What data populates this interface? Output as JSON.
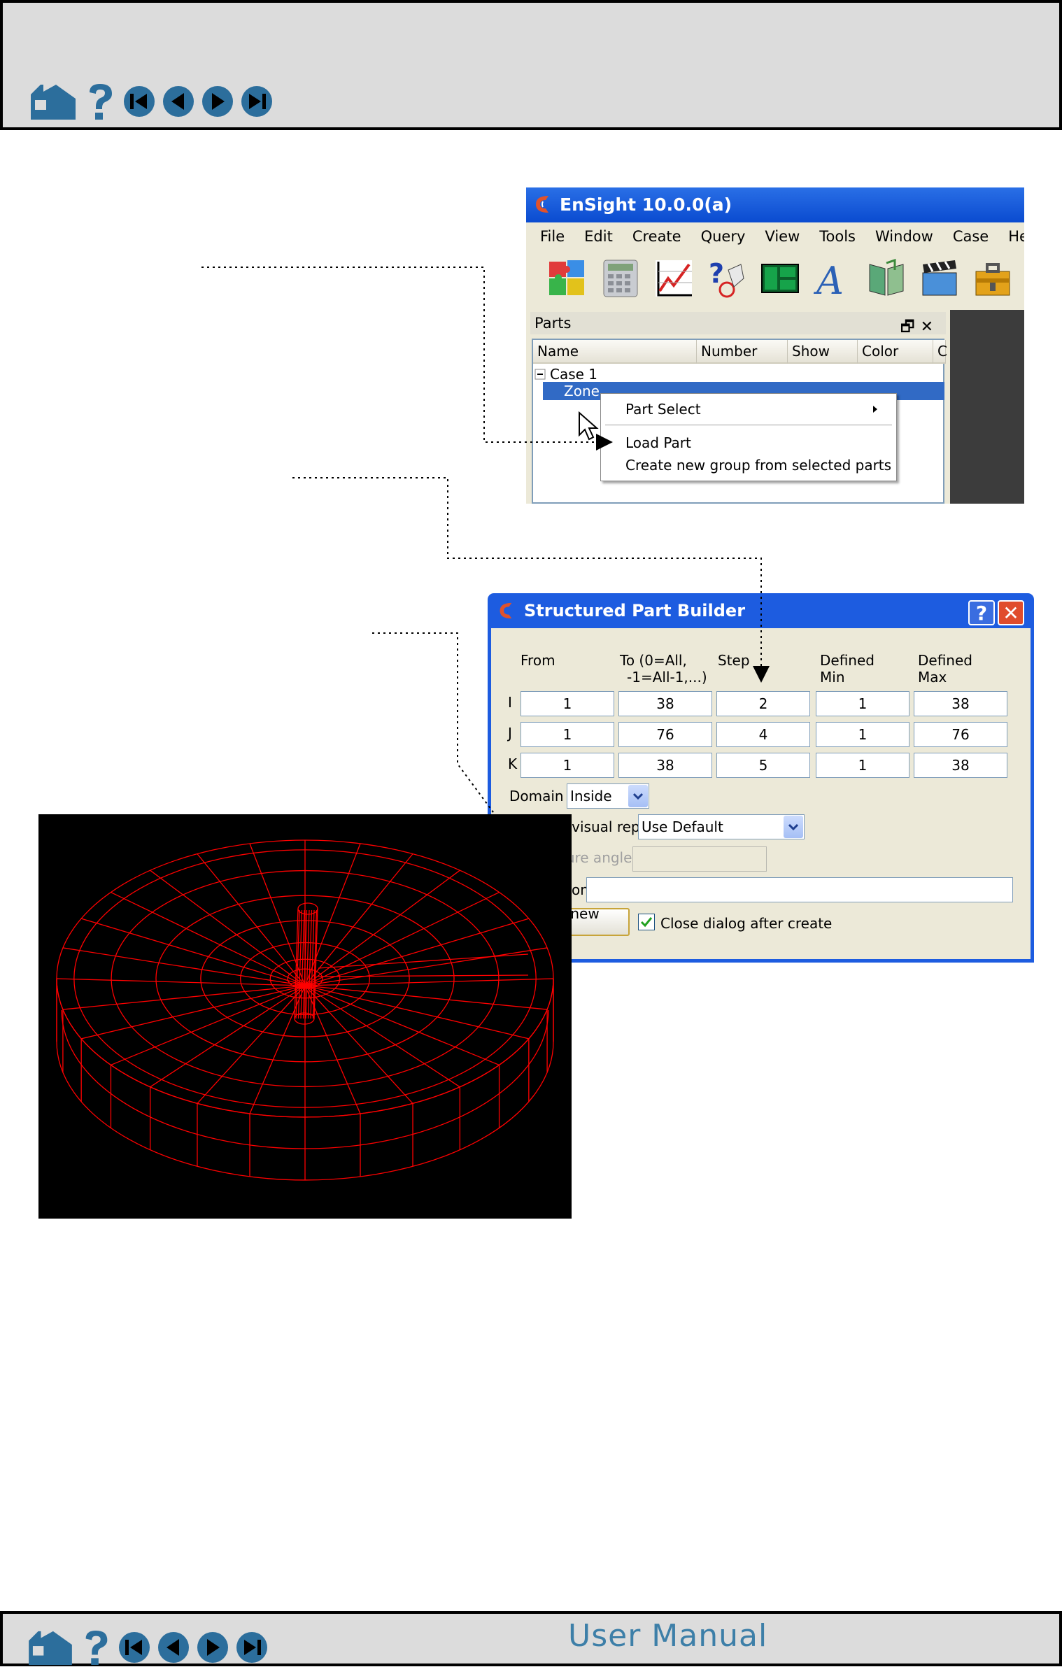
{
  "nav": {
    "icons": [
      "home-icon",
      "help-icon",
      "first-page-icon",
      "previous-page-icon",
      "next-page-icon",
      "last-page-icon"
    ],
    "footer_title": "User Manual",
    "accent": "#2c6e9c"
  },
  "ensight": {
    "title": "EnSight 10.0.0(a)",
    "menus": [
      "File",
      "Edit",
      "Create",
      "Query",
      "View",
      "Tools",
      "Window",
      "Case",
      "Help"
    ],
    "toolbar_icons": [
      "parts-icon",
      "calculator-icon",
      "plot-icon",
      "query-icon",
      "viewports-icon",
      "annotation-icon",
      "book-icon",
      "clapper-icon",
      "toolbox-icon"
    ],
    "parts_panel_title": "Parts",
    "columns": [
      "Name",
      "Number",
      "Show",
      "Color",
      "C"
    ],
    "tree": {
      "case": "Case 1",
      "zone": "Zone"
    }
  },
  "context_menu": {
    "items": [
      "Part Select",
      "Load Part",
      "Create new group from selected parts"
    ]
  },
  "spb": {
    "title": "Structured Part Builder",
    "headers": {
      "from": "From",
      "to_1": "To  (0=All,",
      "to_2": "-1=All-1,...)",
      "step": "Step",
      "dmin_1": "Defined",
      "dmin_2": "Min",
      "dmax_1": "Defined",
      "dmax_2": "Max"
    },
    "rows": [
      {
        "label": "I",
        "from": "1",
        "to": "38",
        "step": "2",
        "min": "1",
        "max": "38"
      },
      {
        "label": "J",
        "from": "1",
        "to": "76",
        "step": "4",
        "min": "1",
        "max": "76"
      },
      {
        "label": "K",
        "from": "1",
        "to": "38",
        "step": "5",
        "min": "1",
        "max": "38"
      }
    ],
    "domain_label": "Domain",
    "domain_value": "Inside",
    "visual_label": "Element visual rep.",
    "visual_value": "Use Default",
    "feature_label": "Feature angle",
    "feature_value": "",
    "description_label": "Description",
    "description_value": "",
    "load_button": "Load as new part",
    "close_label": "Close dialog after create",
    "close_checked": true
  },
  "wireframe": {
    "color": "#ff0000",
    "background": "#000000"
  }
}
